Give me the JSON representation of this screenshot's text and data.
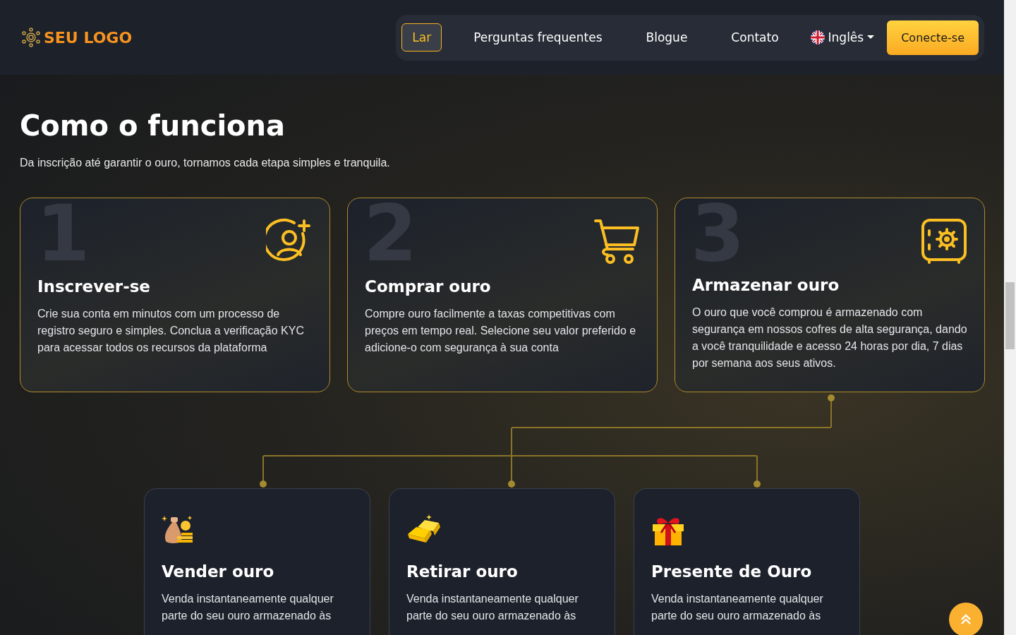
{
  "header": {
    "logo": "SEU LOGO",
    "nav": [
      {
        "label": "Lar",
        "selected": true
      },
      {
        "label": "Perguntas frequentes",
        "selected": false
      },
      {
        "label": "Blogue",
        "selected": false
      },
      {
        "label": "Contato",
        "selected": false
      }
    ],
    "language": "Inglês",
    "cta": "Conecte-se"
  },
  "section": {
    "title": "Como o funciona",
    "subtitle": "Da inscrição até garantir o ouro, tornamos cada etapa simples e tranquila."
  },
  "steps": [
    {
      "number": "1",
      "title": "Inscrever-se",
      "text": "Crie sua conta em minutos com um processo de registro seguro e simples. Conclua a verificação KYC para acessar todos os recursos da plataforma",
      "kind": "user-plus"
    },
    {
      "number": "2",
      "title": "Comprar ouro",
      "text": "Compre ouro facilmente a taxas competitivas com preços em tempo real. Selecione seu valor preferido e adicione-o com segurança à sua conta",
      "kind": "cart"
    },
    {
      "number": "3",
      "title": "Armazenar ouro",
      "text": "O ouro que você comprou é armazenado com segurança em nossos cofres de alta segurança, dando a você tranquilidade e acesso 24 horas por dia, 7 dias por semana aos seus ativos.",
      "kind": "safe"
    }
  ],
  "features": [
    {
      "title": "Vender ouro",
      "text": "Venda instantaneamente qualquer parte do seu ouro armazenado às",
      "kind": "sell"
    },
    {
      "title": "Retirar ouro",
      "text": "Venda instantaneamente qualquer parte do seu ouro armazenado às",
      "kind": "withdraw"
    },
    {
      "title": "Presente de Ouro",
      "text": "Venda instantaneamente qualquer parte do seu ouro armazenado às",
      "kind": "gift"
    }
  ]
}
